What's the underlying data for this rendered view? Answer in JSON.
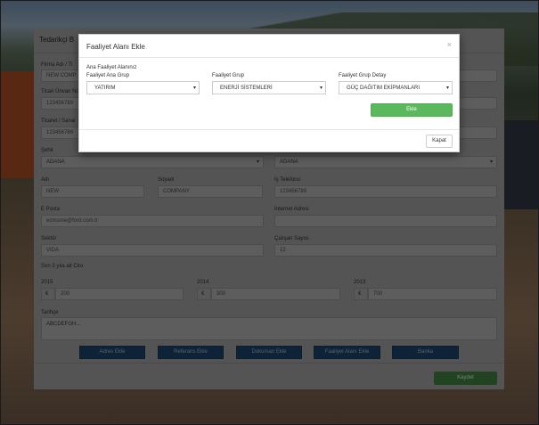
{
  "page": {
    "header_title": "Tedarikçi B",
    "labels": {
      "firma_adi": "Firma Adı / Ti",
      "ticari_unvan": "Ticari Ünvan No",
      "ticaret_sicil": "Ticaret / Sanai",
      "sehir": "Şehir",
      "adi": "Adı",
      "soyadi": "Soyadı",
      "is_telefonu": "İş Telefonu",
      "eposta": "E Posta",
      "internet_adresi": "İnternet Adresi",
      "sektor": "Sektör",
      "calisan_sayisi": "Çalışan Sayısı",
      "son_3_yil": "Son 3 yıla ait Ciro",
      "tarihce": "Tarihçe"
    },
    "values": {
      "firma_adi": "NEW COMP",
      "ticari_unvan": "123456789",
      "ticaret_sicil": "123456789",
      "sehir_1": "ADANA",
      "sehir_2": "ADANA",
      "adi": "NEW",
      "soyadi": "COMPANY",
      "is_telefonu": "123456789",
      "eposta": "ecmsrne@ford.com.tr",
      "internet_adresi": "",
      "sektor": "VIDA",
      "calisan_sayisi": "12",
      "tarihce": "ABCDEFGH..."
    },
    "ciro": [
      {
        "year": "2015",
        "currency": "€",
        "value": "200"
      },
      {
        "year": "2014",
        "currency": "€",
        "value": "300"
      },
      {
        "year": "2013",
        "currency": "€",
        "value": "700"
      }
    ],
    "buttons": {
      "adres_ekle": "Adres Ekle",
      "referans_ekle": "Referans Ekle",
      "dokuman_ekle": "Dokuman Ekle",
      "faaliyet_alani_ekle": "Faaliyet Alanı Ekle",
      "banka": "Banka",
      "kaydet": "Kaydet"
    }
  },
  "modal": {
    "title": "Faaliyet Alanı Ekle",
    "close_glyph": "×",
    "section_label": "Ana Faaliyet Alanınız",
    "fields": {
      "ana_grup_label": "Faaliyet Ana Grup",
      "ana_grup_value": "YATIRIM",
      "grup_label": "Faaliyet Grup",
      "grup_value": "ENERJİ SİSTEMLERİ",
      "grup_detay_label": "Faaliyet Grup Detay",
      "grup_detay_value": "GÜÇ DAĞITIM EKİPMANLARI"
    },
    "add_button": "Ekle",
    "close_button": "Kapat"
  },
  "colors": {
    "primary_button": "#1a3f66",
    "success_button": "#5cb85c",
    "overlay": "rgba(0,0,0,0.45)"
  }
}
